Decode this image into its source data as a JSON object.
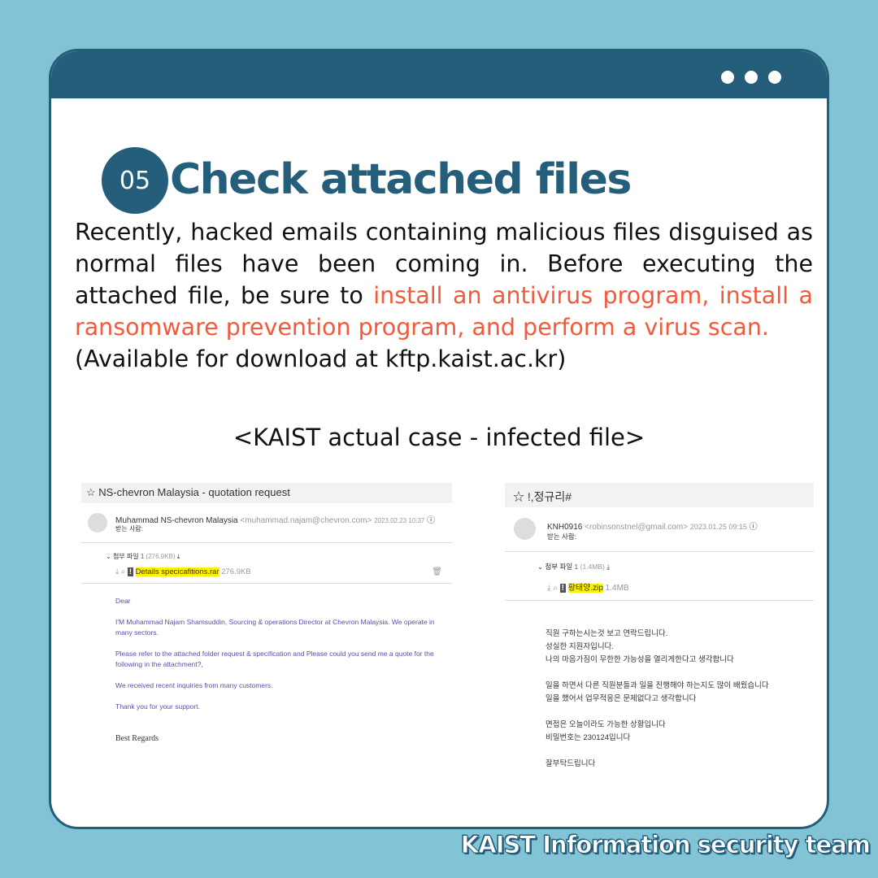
{
  "section": {
    "number": "05",
    "title": "Check attached files"
  },
  "paragraph": {
    "p1": "Recently, hacked emails containing malicious files disguised as normal files have been coming in. Before executing the attached file, be sure to ",
    "highlight": "install an antivirus program, install a ransomware prevention program, and perform a virus scan.",
    "p2": "(Available for download at kftp.kaist.ac.kr)"
  },
  "caption": "<KAIST actual case - infected file>",
  "accent": "#f4593a",
  "brand": "#245e7a",
  "email1": {
    "subject": "NS-chevron Malaysia - quotation request",
    "sender": "Muhammad NS-chevron Malaysia",
    "address": "<muhammad.najam@chevron.com>",
    "date": "2023.02.23 10:37",
    "recipient_label": "받는 사람:",
    "attach_label": "첨부 파일",
    "attach_count": "1",
    "attach_total": "(276.9KB)",
    "file": "Details specicafitions.rar",
    "file_size": "276.9KB",
    "body": [
      "Dear",
      "I'M Muhammad Najam Shamsuddin, Sourcing & operations Director at Chevron Malaysia. We operate in many sectors.",
      "Please refer to the attached folder request & specification and Please could you send me a quote for the following in the attachment?,",
      "We received recent inquiries from many customers.",
      "Thank you for your support."
    ],
    "closing": "Best Regards"
  },
  "email2": {
    "subject": "!,정규리#",
    "sender": "KNH0916",
    "address": "<robinsonstnel@gmail.com>",
    "date": "2023.01.25 09:15",
    "recipient_label": "받는 사람:",
    "attach_label": "첨부 파일",
    "attach_count": "1",
    "attach_total": "(1.4MB)",
    "file": "황태양.zip",
    "file_size": "1.4MB",
    "body": [
      "직원 구하는시는것 보고 연락드립니다.",
      "성실한 지원자입니다.",
      "나의 마음가짐이 무한한 가능성을 열리게한다고 생각합니다",
      "일을 하면서 다른 직원분들과 일을 진행해야 하는지도 많이 배웠습니다",
      "일을 했어서 업무적응은 문제없다고 생각합니다",
      "면접은 오늘이라도 가능한 상황입니다",
      "비밀번호는 230124입니다",
      "잘부탁드립니다"
    ]
  },
  "footer": "KAIST Information security team"
}
